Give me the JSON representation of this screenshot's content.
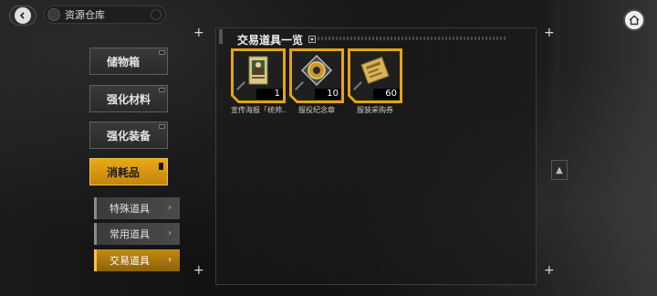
{
  "header": {
    "title": "资源仓库"
  },
  "categories": [
    {
      "label": "储物箱",
      "active": false
    },
    {
      "label": "强化材料",
      "active": false
    },
    {
      "label": "强化装备",
      "active": false
    },
    {
      "label": "消耗品",
      "active": true
    }
  ],
  "subcategories": [
    {
      "label": "特殊道具",
      "active": false
    },
    {
      "label": "常用道具",
      "active": false
    },
    {
      "label": "交易道具",
      "active": true
    }
  ],
  "panel": {
    "title": "交易道具一览"
  },
  "items": [
    {
      "name": "宣传海报「统帅...",
      "count": "1",
      "icon": "poster-icon"
    },
    {
      "name": "服役纪念章",
      "count": "10",
      "icon": "medal-icon"
    },
    {
      "name": "服装采购券",
      "count": "60",
      "icon": "voucher-icon"
    }
  ],
  "colors": {
    "accent": "#e6a314",
    "panel_bg": "#191919"
  }
}
